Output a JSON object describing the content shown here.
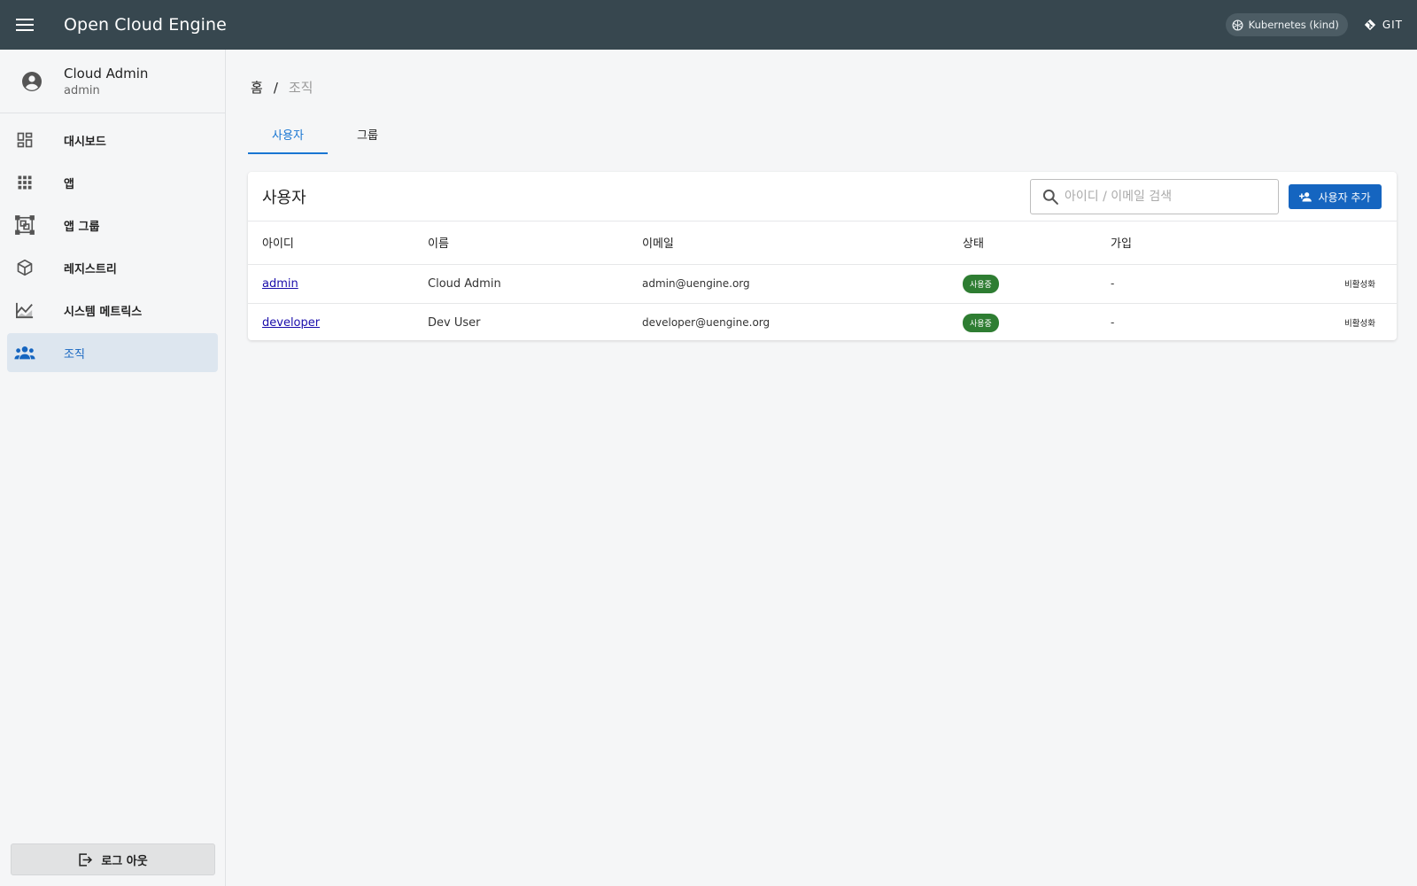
{
  "appbar": {
    "title": "Open Cloud Engine",
    "cluster_chip": "Kubernetes (kind)",
    "git_label": "GIT",
    "bg_color": "#37474f"
  },
  "sidebar": {
    "profile": {
      "name": "Cloud Admin",
      "login": "admin"
    },
    "items": [
      {
        "label": "대시보드",
        "icon": "dashboard-icon"
      },
      {
        "label": "앱",
        "icon": "apps-grid-icon"
      },
      {
        "label": "앱 그룹",
        "icon": "app-group-icon"
      },
      {
        "label": "레지스트리",
        "icon": "package-icon"
      },
      {
        "label": "시스템 메트릭스",
        "icon": "chart-icon"
      },
      {
        "label": "조직",
        "icon": "people-icon",
        "active": true
      }
    ],
    "logout_label": "로그 아웃"
  },
  "breadcrumb": {
    "home": "홈",
    "separator": "/",
    "current": "조직"
  },
  "tabs": [
    {
      "label": "사용자",
      "active": true
    },
    {
      "label": "그룹",
      "active": false
    }
  ],
  "users_card": {
    "title": "사용자",
    "search_placeholder": "아이디 / 이메일 검색",
    "add_button": "사용자 추가",
    "columns": [
      "아이디",
      "이름",
      "이메일",
      "상태",
      "가입"
    ],
    "rows": [
      {
        "id": "admin",
        "name": "Cloud Admin",
        "email": "admin@uengine.org",
        "status": "사용중",
        "joined": "-",
        "action": "비활성화"
      },
      {
        "id": "developer",
        "name": "Dev User",
        "email": "developer@uengine.org",
        "status": "사용중",
        "joined": "-",
        "action": "비활성화"
      }
    ],
    "status_color": "#2e7d32",
    "accent_color": "#1565c0"
  }
}
